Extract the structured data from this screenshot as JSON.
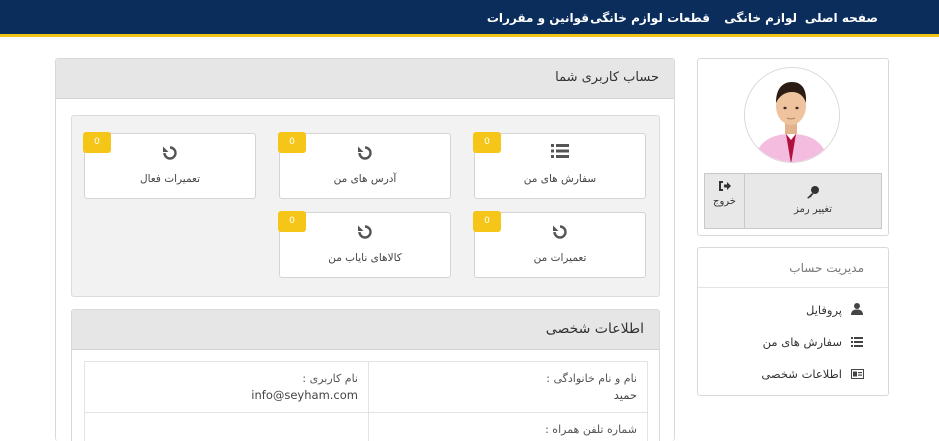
{
  "nav": {
    "items": [
      "صفحه اصلی",
      "لوازم خانگی",
      "قطعات لوازم خانگی",
      "قوانین و مقررات"
    ]
  },
  "account_panel": {
    "title": "حساب کاربری شما",
    "tiles": [
      {
        "label": "سفارش های من",
        "icon": "list-icon",
        "badge": "0"
      },
      {
        "label": "آدرس های من",
        "icon": "refresh-icon",
        "badge": "0"
      },
      {
        "label": "تعمیرات فعال",
        "icon": "refresh-icon",
        "badge": "0"
      },
      {
        "label": "تعمیرات من",
        "icon": "refresh-icon",
        "badge": "0"
      },
      {
        "label": "کالاهای نایاب من",
        "icon": "refresh-icon",
        "badge": "0"
      }
    ]
  },
  "personal_info": {
    "title": "اطلاعات شخصی",
    "fields": [
      {
        "label": "نام و نام خانوادگی :",
        "value": "حمید"
      },
      {
        "label": "نام کاربری :",
        "value": "info@seyham.com"
      },
      {
        "label": "شماره تلفن همراه :",
        "value": ""
      }
    ]
  },
  "profile": {
    "avatar": "user-avatar",
    "change_password_label": "تغییر رمز",
    "logout_label": "خروج"
  },
  "account_menu": {
    "title": "مدیریت حساب",
    "items": [
      {
        "label": "پروفایل",
        "icon": "user-icon"
      },
      {
        "label": "سفارش های من",
        "icon": "list-icon"
      },
      {
        "label": "اطلاعات شخصی",
        "icon": "id-card-icon"
      }
    ]
  },
  "colors": {
    "nav_bg": "#0a2d5c",
    "nav_border": "#f0c419",
    "badge": "#f5c518"
  }
}
